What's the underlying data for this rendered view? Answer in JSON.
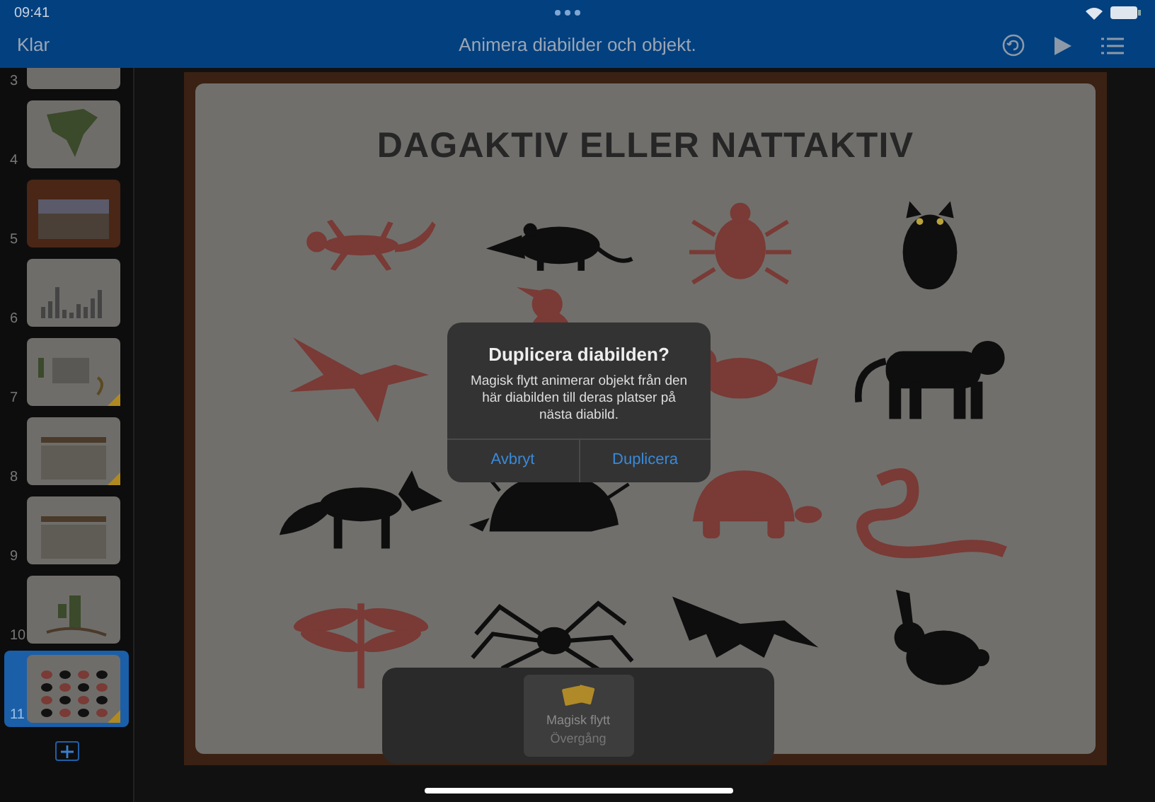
{
  "status_bar": {
    "time": "09:41"
  },
  "toolbar": {
    "done": "Klar",
    "title": "Animera diabilder och objekt."
  },
  "slides": [
    {
      "number": "3",
      "kind": "photos",
      "selected": false,
      "animated": false
    },
    {
      "number": "4",
      "kind": "map",
      "selected": false,
      "animated": false
    },
    {
      "number": "5",
      "kind": "photo",
      "selected": false,
      "animated": false
    },
    {
      "number": "6",
      "kind": "bars",
      "selected": false,
      "animated": false
    },
    {
      "number": "7",
      "kind": "text",
      "selected": false,
      "animated": true
    },
    {
      "number": "8",
      "kind": "table",
      "selected": false,
      "animated": true
    },
    {
      "number": "9",
      "kind": "table",
      "selected": false,
      "animated": false
    },
    {
      "number": "10",
      "kind": "cactus",
      "selected": false,
      "animated": false
    },
    {
      "number": "11",
      "kind": "animals",
      "selected": true,
      "animated": true
    }
  ],
  "slide": {
    "title": "DAGAKTIV ELLER NATTAKTIV",
    "animals": [
      {
        "kind": "lizard",
        "color": "#7a3a35"
      },
      {
        "kind": "rat",
        "color": "#0e0e0e"
      },
      {
        "kind": "beetle",
        "color": "#7a3a35"
      },
      {
        "kind": "owl",
        "color": "#0e0e0e"
      },
      {
        "kind": "eagle",
        "color": "#7a3a35"
      },
      {
        "kind": "crested-bird",
        "color": "#7a3a35"
      },
      {
        "kind": "bird",
        "color": "#7a3a35"
      },
      {
        "kind": "tiger",
        "color": "#0e0e0e"
      },
      {
        "kind": "fox",
        "color": "#0e0e0e"
      },
      {
        "kind": "porcupine",
        "color": "#0e0e0e"
      },
      {
        "kind": "turtle",
        "color": "#7a3a35"
      },
      {
        "kind": "snake",
        "color": "#7a3a35"
      },
      {
        "kind": "dragonfly",
        "color": "#7a3a35"
      },
      {
        "kind": "spider",
        "color": "#0e0e0e"
      },
      {
        "kind": "bat",
        "color": "#0e0e0e"
      },
      {
        "kind": "rabbit",
        "color": "#0e0e0e"
      }
    ]
  },
  "dialog": {
    "title": "Duplicera diabilden?",
    "message": "Magisk flytt animerar objekt från den här diabilden till deras platser på nästa diabild.",
    "buttons": [
      "Avbryt",
      "Duplicera"
    ]
  },
  "transitions": [
    {
      "name": "Magisk flytt",
      "subtitle": "Övergång",
      "selected": true
    }
  ]
}
